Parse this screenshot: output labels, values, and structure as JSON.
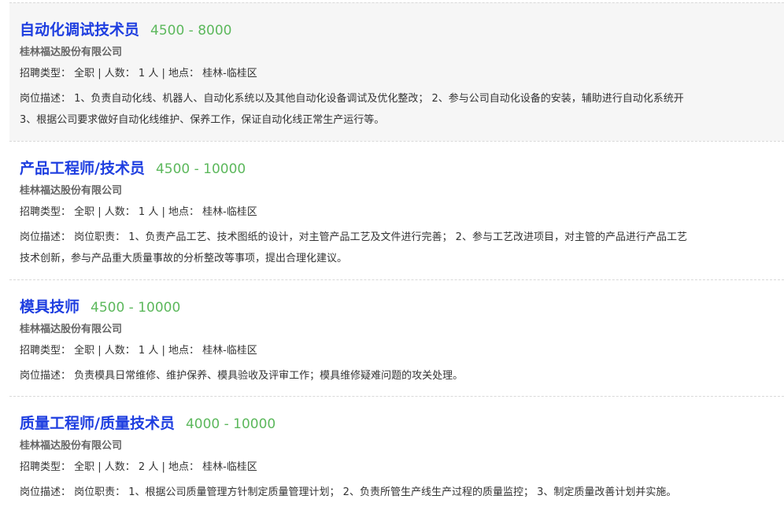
{
  "jobs": [
    {
      "title": "自动化调试技术员",
      "salary": "4500 - 8000",
      "company": "桂林福达股份有限公司",
      "meta": "招聘类型：  全职 | 人数：  1 人 | 地点：  桂林-临桂区",
      "desc_line1": "岗位描述：  1、负责自动化线、机器人、自动化系统以及其他自动化设备调试及优化整改；  2、参与公司自动化设备的安装，辅助进行自动化系统开",
      "desc_line2": "3、根据公司要求做好自动化线维护、保养工作，保证自动化线正常生产运行等。"
    },
    {
      "title": "产品工程师/技术员",
      "salary": "4500 - 10000",
      "company": "桂林福达股份有限公司",
      "meta": "招聘类型：  全职 | 人数：  1 人 | 地点：  桂林-临桂区",
      "desc_line1": "岗位描述：  岗位职责：  1、负责产品工艺、技术图纸的设计，对主管产品工艺及文件进行完善；  2、参与工艺改进项目，对主管的产品进行产品工艺",
      "desc_line2": "技术创新，参与产品重大质量事故的分析整改等事项，提出合理化建议。"
    },
    {
      "title": "模具技师",
      "salary": "4500 - 10000",
      "company": "桂林福达股份有限公司",
      "meta": "招聘类型：  全职 | 人数：  1 人 | 地点：  桂林-临桂区",
      "desc_line1": "岗位描述：  负责模具日常维修、维护保养、模具验收及评审工作；模具维修疑难问题的攻关处理。"
    },
    {
      "title": "质量工程师/质量技术员",
      "salary": "4000 - 10000",
      "company": "桂林福达股份有限公司",
      "meta": "招聘类型：  全职 | 人数：  2 人 | 地点：  桂林-临桂区",
      "desc_line1": "岗位描述：  岗位职责：  1、根据公司质量管理方针制定质量管理计划；  2、负责所管生产线生产过程的质量监控；  3、制定质量改善计划并实施。"
    }
  ],
  "colors": {
    "title": "#1e3ee0",
    "salary": "#5cb85c",
    "company": "#666666",
    "text": "#333333",
    "highlight_bg": "#f6f6f6"
  }
}
